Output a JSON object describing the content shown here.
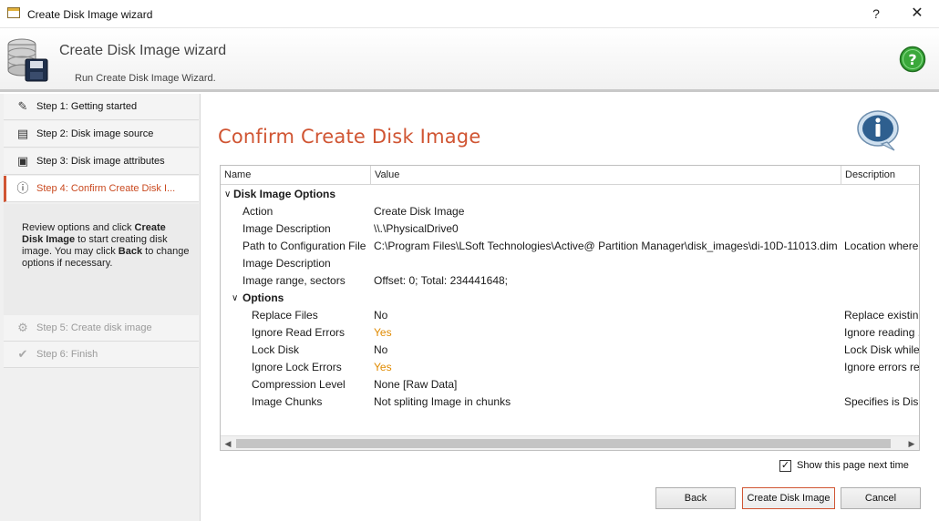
{
  "window": {
    "title": "Create Disk Image wizard",
    "help_glyph": "?",
    "close_glyph": "✕"
  },
  "banner": {
    "title": "Create Disk Image wizard",
    "subtitle": "Run Create Disk Image Wizard.",
    "help_icon": "green-question-icon"
  },
  "sidebar": {
    "steps": [
      {
        "label": "Step 1: Getting started",
        "icon": "wand-icon",
        "glyph": "✎",
        "state": "normal"
      },
      {
        "label": "Step 2: Disk image source",
        "icon": "disk-source-icon",
        "glyph": "▤",
        "state": "normal"
      },
      {
        "label": "Step 3: Disk image attributes",
        "icon": "disk-attributes-icon",
        "glyph": "▣",
        "state": "normal"
      },
      {
        "label": "Step 4: Confirm Create Disk I...",
        "icon": "info-icon",
        "glyph": "ⓘ",
        "state": "active"
      },
      {
        "label": "Step 5: Create disk image",
        "icon": "gear-icon",
        "glyph": "⚙",
        "state": "disabled"
      },
      {
        "label": "Step 6: Finish",
        "icon": "check-icon",
        "glyph": "✔",
        "state": "disabled"
      }
    ],
    "help": {
      "p1": "Review options and click ",
      "b1": "Create Disk Image",
      "p2": " to start creating disk image. You may click ",
      "b2": "Back",
      "p3": " to change options if necessary."
    }
  },
  "main": {
    "page_title": "Confirm Create Disk Image",
    "columns": {
      "name": "Name",
      "value": "Value",
      "description": "Description"
    },
    "group1": "Disk Image Options",
    "group2": "Options",
    "rows1": [
      {
        "name": "Action",
        "value": "Create Disk Image",
        "desc": ""
      },
      {
        "name": "Image Description",
        "value": "\\\\.\\PhysicalDrive0",
        "desc": ""
      },
      {
        "name": "Path to Configuration File",
        "value": "C:\\Program Files\\LSoft Technologies\\Active@ Partition Manager\\disk_images\\di-10D-11013.dim",
        "desc": "Location where"
      },
      {
        "name": "Image Description",
        "value": "",
        "desc": ""
      },
      {
        "name": "Image range, sectors",
        "value": "Offset: 0; Total: 234441648;",
        "desc": ""
      }
    ],
    "rows2": [
      {
        "name": "Replace Files",
        "value": "No",
        "desc": "Replace existin..."
      },
      {
        "name": "Ignore Read Errors",
        "value": "Yes",
        "desc": "Ignore reading ..."
      },
      {
        "name": "Lock Disk",
        "value": "No",
        "desc": "Lock Disk while"
      },
      {
        "name": "Ignore Lock Errors",
        "value": "Yes",
        "desc": "Ignore errors re..."
      },
      {
        "name": "Compression Level",
        "value": "None [Raw Data]",
        "desc": ""
      },
      {
        "name": "Image Chunks",
        "value": "Not spliting Image in chunks",
        "desc": "Specifies is Disk"
      }
    ],
    "show_next_label": "Show this page next time",
    "show_next_checked": true,
    "buttons": {
      "back": "Back",
      "create": "Create Disk Image",
      "cancel": "Cancel"
    }
  },
  "colors": {
    "accent": "#d05533",
    "yes_value": "#e08a00"
  }
}
